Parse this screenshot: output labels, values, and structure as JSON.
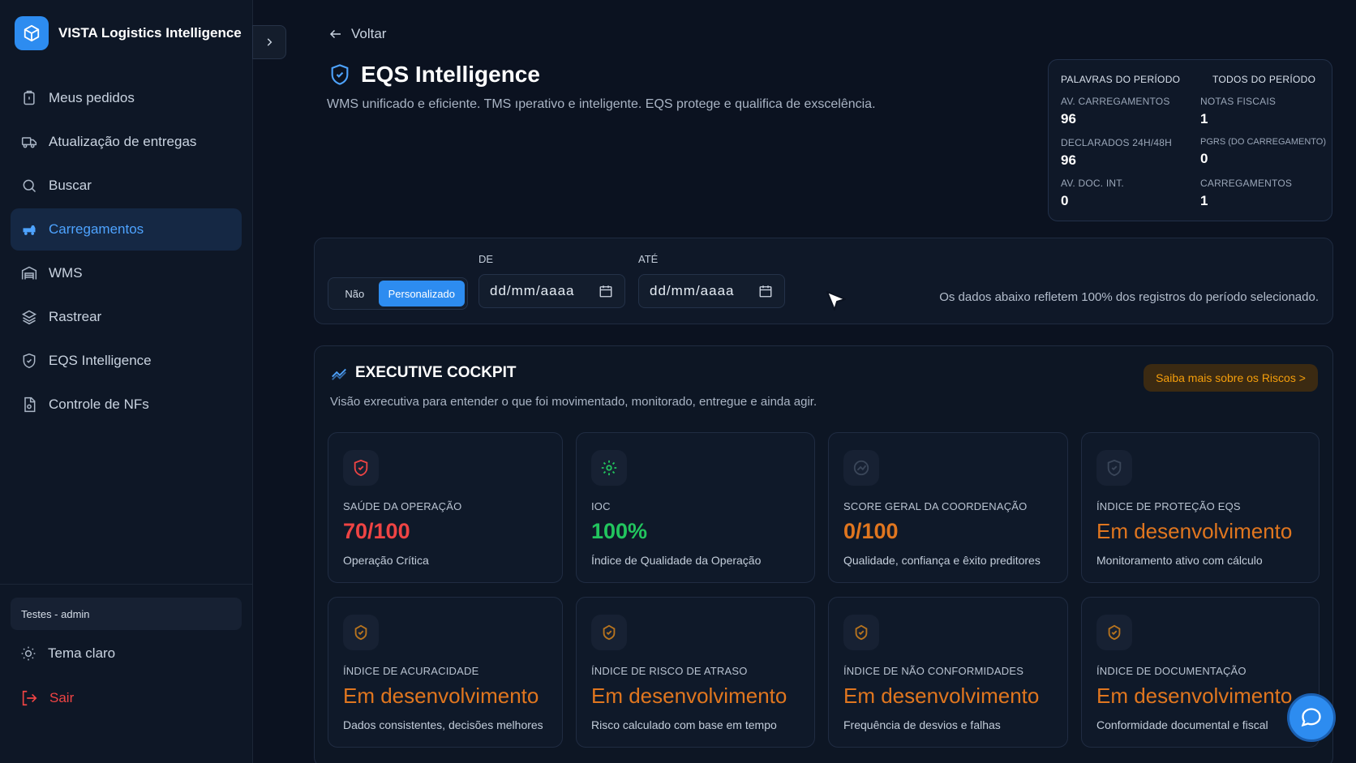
{
  "app": {
    "title": "VISTA Logistics Intelligence"
  },
  "sidebar": {
    "items": [
      {
        "label": "Meus pedidos",
        "icon": "clipboard-icon"
      },
      {
        "label": "Atualização de entregas",
        "icon": "truck-icon"
      },
      {
        "label": "Buscar",
        "icon": "search-icon"
      },
      {
        "label": "Carregamentos",
        "icon": "loading-truck-icon",
        "active": true
      },
      {
        "label": "WMS",
        "icon": "warehouse-icon"
      },
      {
        "label": "Rastrear",
        "icon": "layers-icon"
      },
      {
        "label": "EQS Intelligence",
        "icon": "shield-icon"
      },
      {
        "label": "Controle de NFs",
        "icon": "document-icon"
      }
    ],
    "user": "Testes - admin",
    "theme_label": "Tema claro",
    "logout_label": "Sair"
  },
  "header": {
    "back_label": "Voltar",
    "title": "EQS Intelligence",
    "subtitle": "WMS unificado e eficiente. TMS ıperativo e inteligente. EQS protege e qualifica de exscelência."
  },
  "stats": {
    "left_header": "PALAVRAS DO PERÍODO",
    "right_header": "TODOS DO PERÍODO",
    "items": [
      {
        "label": "AV. CARREGAMENTOS",
        "value": "96"
      },
      {
        "label": "NOTAS FISCAIS",
        "value": "1"
      },
      {
        "label": "DECLARADOS 24H/48H",
        "value": "96"
      },
      {
        "label": "PGRS (DO CARREGAMENTO)",
        "value": "0"
      },
      {
        "label": "AV. DOC. INT.",
        "value": "0"
      },
      {
        "label": "CARREGAMENTOS",
        "value": "1"
      }
    ]
  },
  "filter": {
    "toggle_off": "Não",
    "toggle_on": "Personalizado",
    "from_label": "DE",
    "to_label": "ATÉ",
    "from_value": "dd/mm/aaaa",
    "to_value": "dd/mm/aaaa",
    "note": "Os dados abaixo refletem 100% dos registros do período selecionado."
  },
  "cockpit": {
    "title": "EXECUTIVE COCKPIT",
    "subtitle": "Visão exrecutiva para entender o que foi movimentado, monitorado, entregue e ainda agir.",
    "risk_button": "Saiba mais sobre os Riscos >",
    "cards": [
      {
        "label": "SAÚDE DA OPERAÇÃO",
        "value": "70/100",
        "desc": "Operação Crítica",
        "color": "#ef4444",
        "icon": "shield-icon"
      },
      {
        "label": "IOC",
        "value": "100%",
        "desc": "Índice de Qualidade da Operação",
        "color": "#22c55e",
        "icon": "gear-icon"
      },
      {
        "label": "SCORE GERAL DA COORDENAÇÃO",
        "value": "0/100",
        "desc": "Qualidade, confiança e êxito preditores",
        "color": "#e0761f",
        "icon": "trend-icon"
      },
      {
        "label": "ÍNDICE DE PROTEÇÃO EQS",
        "value": "Em desenvolvimento",
        "desc": "Monitoramento ativo com cálculo",
        "color": "#e0761f",
        "icon": "shield-icon"
      },
      {
        "label": "ÍNDICE DE ACURACIDADE",
        "value": "Em desenvolvimento",
        "desc": "Dados consistentes, decisões melhores",
        "color": "#e0761f",
        "icon": "badge-icon"
      },
      {
        "label": "ÍNDICE DE RISCO DE ATRASO",
        "value": "Em desenvolvimento",
        "desc": "Risco calculado com base em tempo",
        "color": "#e0761f",
        "icon": "badge-icon"
      },
      {
        "label": "ÍNDICE DE NÃO CONFORMIDADES",
        "value": "Em desenvolvimento",
        "desc": "Frequência de desvios e falhas",
        "color": "#e0761f",
        "icon": "badge-icon"
      },
      {
        "label": "ÍNDICE DE DOCUMENTAÇÃO",
        "value": "Em desenvolvimento",
        "desc": "Conformidade documental e fiscal",
        "color": "#e0761f",
        "icon": "badge-icon"
      }
    ]
  }
}
